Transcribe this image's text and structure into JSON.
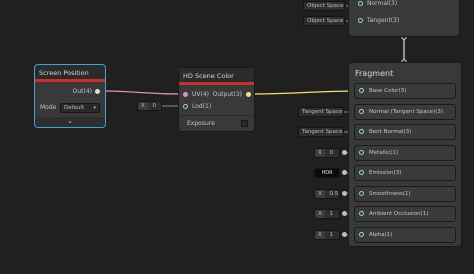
{
  "top_panel": {
    "rows": [
      {
        "field": "Object Space",
        "port_label": "Normal(3)"
      },
      {
        "field": "Object Space",
        "port_label": "Tangent(3)"
      }
    ]
  },
  "screen_position": {
    "title": "Screen Position",
    "output_label": "Out(4)",
    "mode_label": "Mode",
    "mode_value": "Default",
    "expand_icon": "chevron-down-icon"
  },
  "hd_scene_color": {
    "title": "HD Scene Color",
    "inputs": [
      {
        "label": "UV(4)"
      },
      {
        "label": "Lod(1)"
      }
    ],
    "output_label": "Output(3)",
    "exposure_label": "Exposure",
    "lod_input": {
      "label": "X",
      "value": "0"
    }
  },
  "fragment": {
    "title": "Fragment",
    "rows": [
      {
        "label": "Base Color(3)"
      },
      {
        "label": "Normal (Tangent Space)(3)",
        "input_field": "Tangent Space"
      },
      {
        "label": "Bent Normal(3)",
        "input_field": "Tangent Space"
      },
      {
        "label": "Metallic(1)",
        "input_label": "X",
        "input_value": "0"
      },
      {
        "label": "Emission(3)",
        "input_badge": "HDR"
      },
      {
        "label": "Smoothness(1)",
        "input_label": "X",
        "input_value": "0.5"
      },
      {
        "label": "Ambient Occlusion(1)",
        "input_label": "X",
        "input_value": "1"
      },
      {
        "label": "Alpha(1)",
        "input_label": "X",
        "input_value": "1"
      }
    ]
  },
  "colors": {
    "background": "#202020",
    "node_body": "#393939",
    "node_header": "#2b2b2b",
    "accent_red": "#c62f2f",
    "selection_blue": "#44a3d6",
    "wire_pink": "#e28fc1",
    "wire_white": "#dcdcdc",
    "wire_yellow": "#f3e27b"
  }
}
